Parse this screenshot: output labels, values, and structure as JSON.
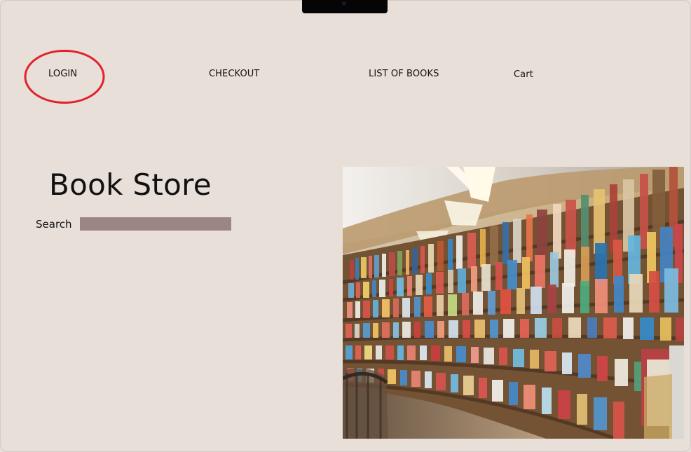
{
  "nav": {
    "login": "LOGIN",
    "checkout": "CHECKOUT",
    "list_of_books": "LIST OF BOOKS",
    "cart": "Cart"
  },
  "page": {
    "title": "Book Store"
  },
  "search": {
    "label": "Search",
    "value": ""
  },
  "colors": {
    "background": "#e8dfd9",
    "search_field": "#9b8585",
    "annotation_circle": "#e2212a"
  },
  "icons": {
    "hero_image": "library-bookshelves-image",
    "annotation": "red-annotation-circle"
  }
}
